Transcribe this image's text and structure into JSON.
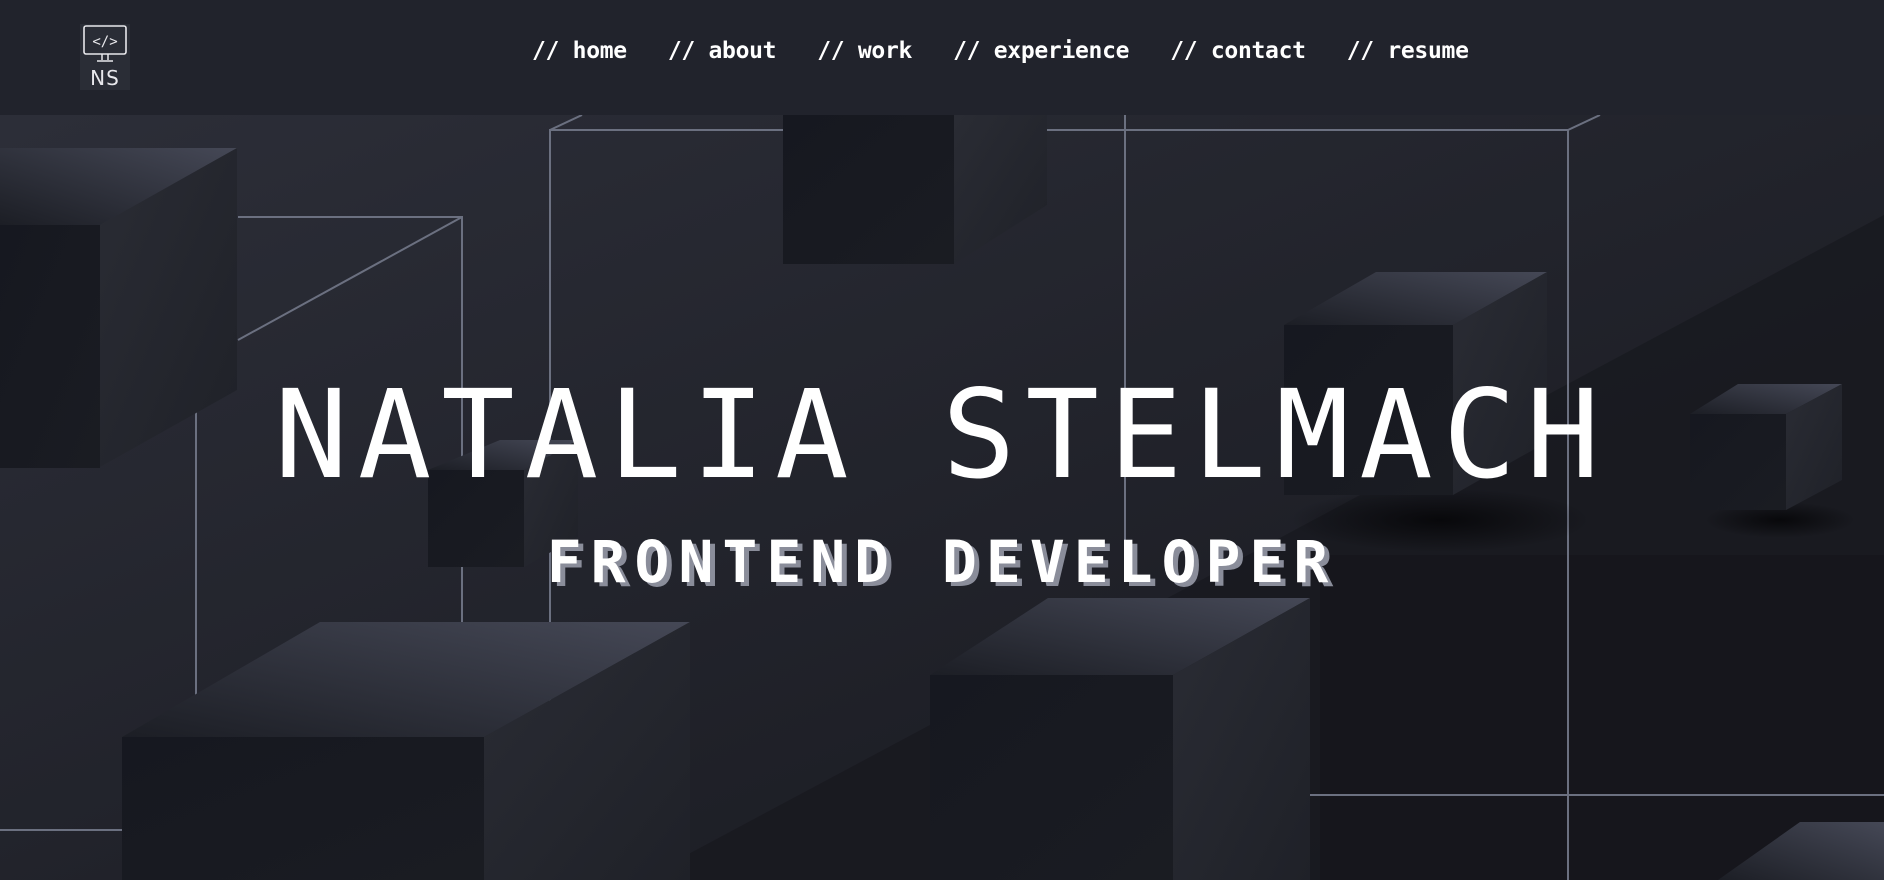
{
  "logo": {
    "icon": "monitor-code-icon",
    "initials": "NS"
  },
  "nav": {
    "items": [
      {
        "label": "// home"
      },
      {
        "label": "// about"
      },
      {
        "label": "// work"
      },
      {
        "label": "// experience"
      },
      {
        "label": "// contact"
      },
      {
        "label": "// resume"
      }
    ]
  },
  "hero": {
    "name": "NATALIA STELMACH",
    "role": "FRONTEND DEVELOPER"
  },
  "colors": {
    "header_bg": "#21232c",
    "page_bg": "#1f2129",
    "text": "#ffffff",
    "subtitle_shadow": "#8a8d9a",
    "wireframe": "#6b7080"
  }
}
